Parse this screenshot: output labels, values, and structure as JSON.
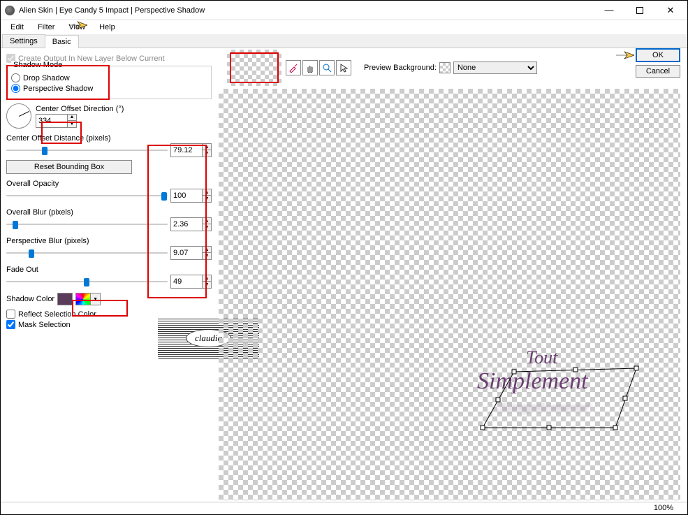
{
  "window": {
    "title": "Alien Skin | Eye Candy 5 Impact | Perspective Shadow",
    "minimize": "—",
    "close": "✕"
  },
  "menubar": [
    "Edit",
    "Filter",
    "View",
    "Help"
  ],
  "tabs": {
    "settings": "Settings",
    "basic": "Basic"
  },
  "left": {
    "create_output": "Create Output In New Layer Below Current",
    "shadow_mode": {
      "legend": "Shadow Mode",
      "drop": "Drop Shadow",
      "perspective": "Perspective Shadow"
    },
    "direction": {
      "label": "Center Offset Direction (°)",
      "value": "334"
    },
    "distance": {
      "label": "Center Offset Distance (pixels)",
      "value": "79.12"
    },
    "reset_bb": "Reset Bounding Box",
    "opacity": {
      "label": "Overall Opacity",
      "value": "100"
    },
    "blur": {
      "label": "Overall Blur (pixels)",
      "value": "2.36"
    },
    "pblur": {
      "label": "Perspective Blur (pixels)",
      "value": "9.07"
    },
    "fade": {
      "label": "Fade Out",
      "value": "49"
    },
    "shadow_color": "Shadow Color",
    "reflect": "Reflect Selection Color",
    "mask": "Mask Selection"
  },
  "right": {
    "preview_bg_label": "Preview Background:",
    "preview_bg_value": "None",
    "ok": "OK",
    "cancel": "Cancel"
  },
  "canvas": {
    "text1": "Tout",
    "text2": "Simplement",
    "shadow": "Simplement"
  },
  "watermark": "claudia",
  "status": {
    "zoom": "100%"
  }
}
